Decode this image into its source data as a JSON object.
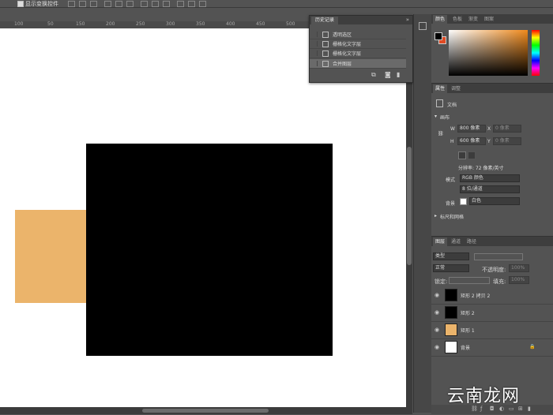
{
  "options_bar": {
    "checkbox_label": "显示变换控件"
  },
  "ruler": {
    "ticks": [
      "100",
      "50",
      "150",
      "200",
      "250",
      "300",
      "350",
      "400",
      "450",
      "500"
    ]
  },
  "actions_panel": {
    "tab": "历史记录",
    "menu_glyph": "»",
    "items": [
      {
        "label": "透明选区",
        "selected": false
      },
      {
        "label": "栅格化文字层",
        "selected": false
      },
      {
        "label": "栅格化文字层",
        "selected": false
      },
      {
        "label": "合并图层",
        "selected": true
      }
    ]
  },
  "color_panel": {
    "tabs": [
      "颜色",
      "色板",
      "渐变",
      "图案"
    ],
    "foreground": "#000000",
    "background": "#e04a24"
  },
  "properties_panel": {
    "tabs": [
      "属性",
      "调整"
    ],
    "doc_label": "文档",
    "section_canvas": "画布",
    "w_label": "W",
    "w_value": "800 像素",
    "h_label": "H",
    "h_value": "600 像素",
    "x_label": "X",
    "x_value": "0 像素",
    "y_label": "Y",
    "y_value": "0 像素",
    "resolution": "分辨率: 72 像素/英寸",
    "mode_label": "模式",
    "mode_value": "RGB 颜色",
    "depth_value": "8 位/通道",
    "bg_label": "背景",
    "bg_value": "白色",
    "section_guides": "标尺和网格"
  },
  "layers_panel": {
    "tabs": [
      "图层",
      "通道",
      "路径"
    ],
    "filter_kind": "类型",
    "blend_mode": "正常",
    "opacity_label": "不透明度:",
    "opacity_value": "100%",
    "lock_label": "锁定:",
    "fill_label": "填充:",
    "fill_value": "100%",
    "layers": [
      {
        "name": "矩形 2 拷贝 2",
        "thumb": "#000000",
        "locked": false
      },
      {
        "name": "矩形 2",
        "thumb": "#000000",
        "locked": false
      },
      {
        "name": "矩形 1",
        "thumb": "#ebb46b",
        "locked": false
      },
      {
        "name": "背景",
        "thumb": "#ffffff",
        "locked": true
      }
    ]
  },
  "canvas": {
    "orange_layer_color": "#ebb46b",
    "black_layer_color": "#000000"
  },
  "watermark": "云南龙网"
}
